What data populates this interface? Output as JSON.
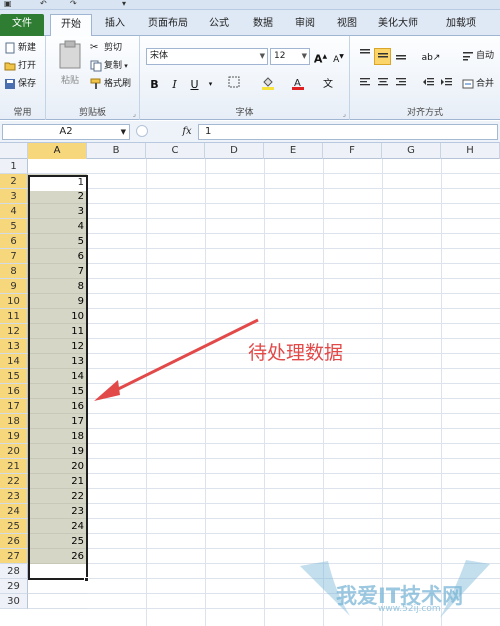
{
  "quick_access": {
    "undo": "↶",
    "redo": "↷",
    "more": "▾"
  },
  "tabs": [
    {
      "label": "文件"
    },
    {
      "label": "开始"
    },
    {
      "label": "插入"
    },
    {
      "label": "页面布局"
    },
    {
      "label": "公式"
    },
    {
      "label": "数据"
    },
    {
      "label": "审阅"
    },
    {
      "label": "视图"
    },
    {
      "label": "美化大师"
    },
    {
      "label": "加载项"
    }
  ],
  "ribbon": {
    "common": {
      "new": "新建",
      "open": "打开",
      "save": "保存",
      "label": "常用"
    },
    "clipboard": {
      "paste": "粘贴",
      "cut": "剪切",
      "copy": "复制",
      "format_painter": "格式刷",
      "label": "剪贴板"
    },
    "font": {
      "name": "宋体",
      "size": "12",
      "grow": "A",
      "shrink": "A",
      "bold": "B",
      "italic": "I",
      "underline": "U",
      "wen": "文",
      "label": "字体"
    },
    "align": {
      "wrap": "自动",
      "merge": "合并",
      "label": "对齐方式"
    }
  },
  "formula_bar": {
    "name_box": "A2",
    "fx": "fx",
    "value": "1"
  },
  "columns": [
    "A",
    "B",
    "C",
    "D",
    "E",
    "F",
    "G",
    "H"
  ],
  "rows": [
    {
      "n": "1",
      "a": ""
    },
    {
      "n": "2",
      "a": "1"
    },
    {
      "n": "3",
      "a": "2"
    },
    {
      "n": "4",
      "a": "3"
    },
    {
      "n": "5",
      "a": "4"
    },
    {
      "n": "6",
      "a": "5"
    },
    {
      "n": "7",
      "a": "6"
    },
    {
      "n": "8",
      "a": "7"
    },
    {
      "n": "9",
      "a": "8"
    },
    {
      "n": "10",
      "a": "9"
    },
    {
      "n": "11",
      "a": "10"
    },
    {
      "n": "12",
      "a": "11"
    },
    {
      "n": "13",
      "a": "12"
    },
    {
      "n": "14",
      "a": "13"
    },
    {
      "n": "15",
      "a": "14"
    },
    {
      "n": "16",
      "a": "15"
    },
    {
      "n": "17",
      "a": "16"
    },
    {
      "n": "18",
      "a": "17"
    },
    {
      "n": "19",
      "a": "18"
    },
    {
      "n": "20",
      "a": "19"
    },
    {
      "n": "21",
      "a": "20"
    },
    {
      "n": "22",
      "a": "21"
    },
    {
      "n": "23",
      "a": "22"
    },
    {
      "n": "24",
      "a": "23"
    },
    {
      "n": "25",
      "a": "24"
    },
    {
      "n": "26",
      "a": "25"
    },
    {
      "n": "27",
      "a": "26"
    },
    {
      "n": "28",
      "a": ""
    },
    {
      "n": "29",
      "a": ""
    },
    {
      "n": "30",
      "a": ""
    }
  ],
  "annotation": {
    "text": "待处理数据",
    "color": "#e24a4a"
  },
  "watermark": {
    "text": "我爱IT技术网",
    "url": "www.52ij.com"
  },
  "colors": {
    "selection_header": "#f7d77c",
    "selection_fill": "#d6d6c6",
    "file_tab": "#2e7d32"
  }
}
